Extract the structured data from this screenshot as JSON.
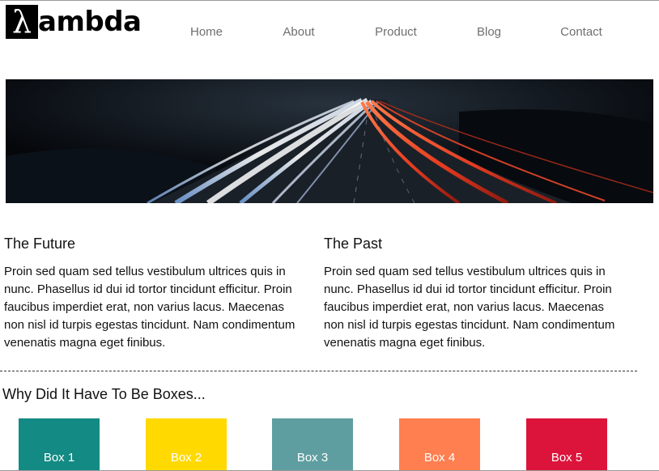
{
  "logo": {
    "mark": "λ",
    "text": "ambda"
  },
  "nav": {
    "items": [
      {
        "label": "Home"
      },
      {
        "label": "About"
      },
      {
        "label": "Product"
      },
      {
        "label": "Blog"
      },
      {
        "label": "Contact"
      }
    ]
  },
  "sections": [
    {
      "title": "The Future",
      "body": "Proin sed quam sed tellus vestibulum ultrices quis in nunc. Phasellus id dui id tortor tincidunt efficitur. Proin faucibus imperdiet erat, non varius lacus. Maecenas non nisl id turpis egestas tincidunt. Nam condimentum venenatis magna eget finibus."
    },
    {
      "title": "The Past",
      "body": "Proin sed quam sed tellus vestibulum ultrices quis in nunc. Phasellus id dui id tortor tincidunt efficitur. Proin faucibus imperdiet erat, non varius lacus. Maecenas non nisl id turpis egestas tincidunt. Nam condimentum venenatis magna eget finibus."
    }
  ],
  "boxes_section": {
    "title": "Why Did It Have To Be Boxes..."
  },
  "boxes": [
    {
      "label": "Box 1",
      "color": "#138a83"
    },
    {
      "label": "Box 2",
      "color": "#ffd900"
    },
    {
      "label": "Box 3",
      "color": "#5f9ea0"
    },
    {
      "label": "Box 4",
      "color": "#ff7f50"
    },
    {
      "label": "Box 5",
      "color": "#dc143c"
    }
  ]
}
